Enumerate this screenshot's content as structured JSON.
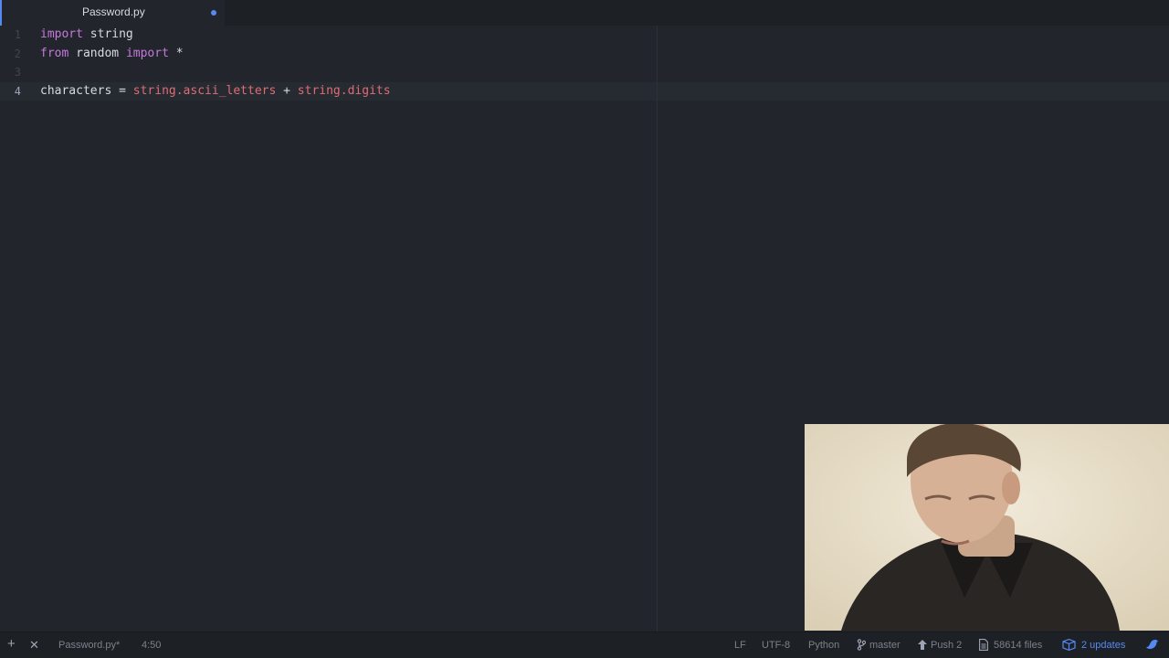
{
  "tabs": [
    {
      "title": "Password.py",
      "modified": true
    }
  ],
  "editor": {
    "gutter": [
      "1",
      "2",
      "3",
      "4"
    ],
    "cursor_line": 4
  },
  "code": {
    "line1": {
      "kw": "import",
      "rest": " string"
    },
    "line2": {
      "kw1": "from",
      "mid": " random ",
      "kw2": "import",
      "rest": " *"
    },
    "line3": "",
    "line4": {
      "name": "characters",
      "eq": " = ",
      "mod1": "string",
      "attr1": ".ascii_letters",
      "plus": " + ",
      "mod2": "string",
      "attr2": ".digits"
    }
  },
  "webcam": {
    "icon": "person-webcam"
  },
  "statusbar": {
    "add_icon": "+",
    "close_icon": "✕",
    "file": "Password.py*",
    "cursor_position": "4:50",
    "line_ending": "LF",
    "encoding": "UTF-8",
    "grammar": "Python",
    "branch_icon": "git-branch-icon",
    "branch": "master",
    "push_icon": "arrow-up-icon",
    "push": "Push 2",
    "files_icon": "file-icon",
    "files": "58614 files",
    "updates_icon": "package-icon",
    "updates": "2 updates",
    "bird_icon": "bird-icon"
  },
  "colors": {
    "accent": "#568af2",
    "keyword": "#c678dd",
    "module": "#e06c75",
    "background": "#22262c"
  }
}
